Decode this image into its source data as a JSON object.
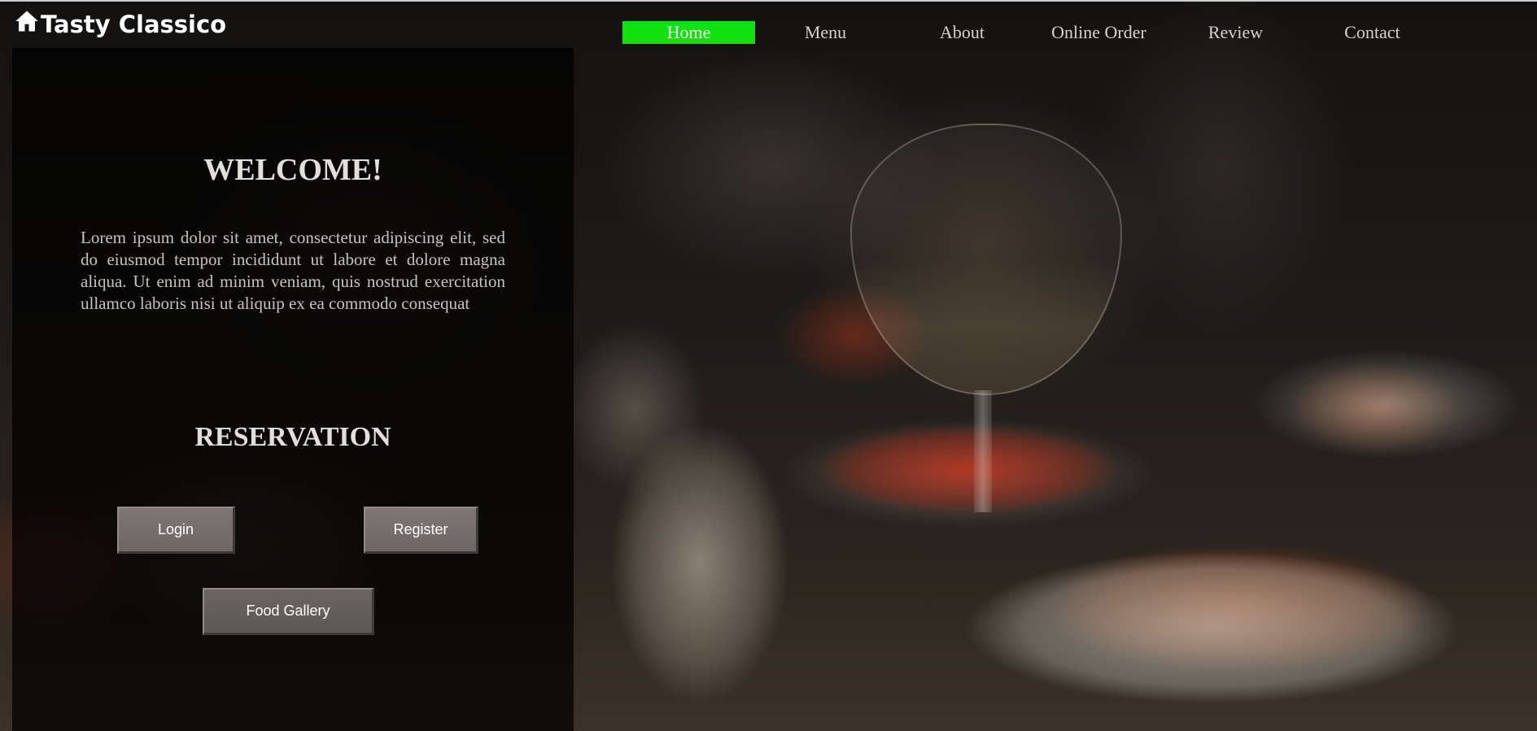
{
  "brand": {
    "name": "Tasty Classico",
    "icon": "home-icon"
  },
  "nav": {
    "items": [
      "Home",
      "Menu",
      "About",
      "Online Order",
      "Review",
      "Contact"
    ],
    "active": "Home",
    "active_color": "#0fe20f"
  },
  "hero": {
    "welcome_title": "WELCOME!",
    "intro_text": "Lorem ipsum dolor sit amet, consectetur adipiscing elit, sed do eiusmod tempor incididunt ut labore et dolore magna aliqua. Ut enim ad minim veniam, quis nostrud exercitation ullamco laboris nisi ut aliquip ex ea commodo consequat",
    "reservation_title": "RESERVATION"
  },
  "actions": {
    "login_label": "Login",
    "register_label": "Register",
    "gallery_label": "Food Gallery"
  }
}
